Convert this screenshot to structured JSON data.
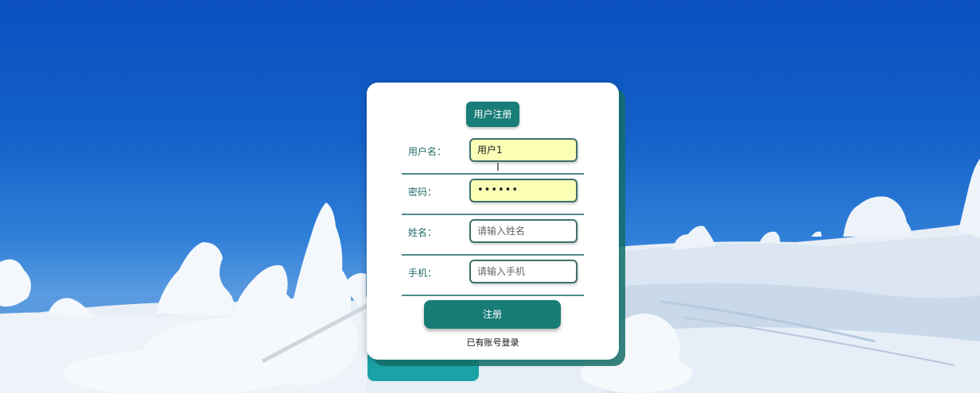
{
  "form": {
    "title": "用户注册",
    "fields": [
      {
        "label": "用户名：",
        "value": "用户1",
        "placeholder": ""
      },
      {
        "label": "密码：",
        "value": "••••••",
        "placeholder": ""
      },
      {
        "label": "姓名：",
        "value": "",
        "placeholder": "请输入姓名"
      },
      {
        "label": "手机：",
        "value": "",
        "placeholder": "请输入手机"
      }
    ],
    "submit_label": "注册",
    "login_link": "已有账号登录"
  },
  "colors": {
    "accent": "#187d76",
    "filled_field": "#fbffb6",
    "sky": "#0b4fc0"
  },
  "background": {
    "icons": [
      "snowy-trees",
      "skier",
      "ski-pole"
    ]
  }
}
